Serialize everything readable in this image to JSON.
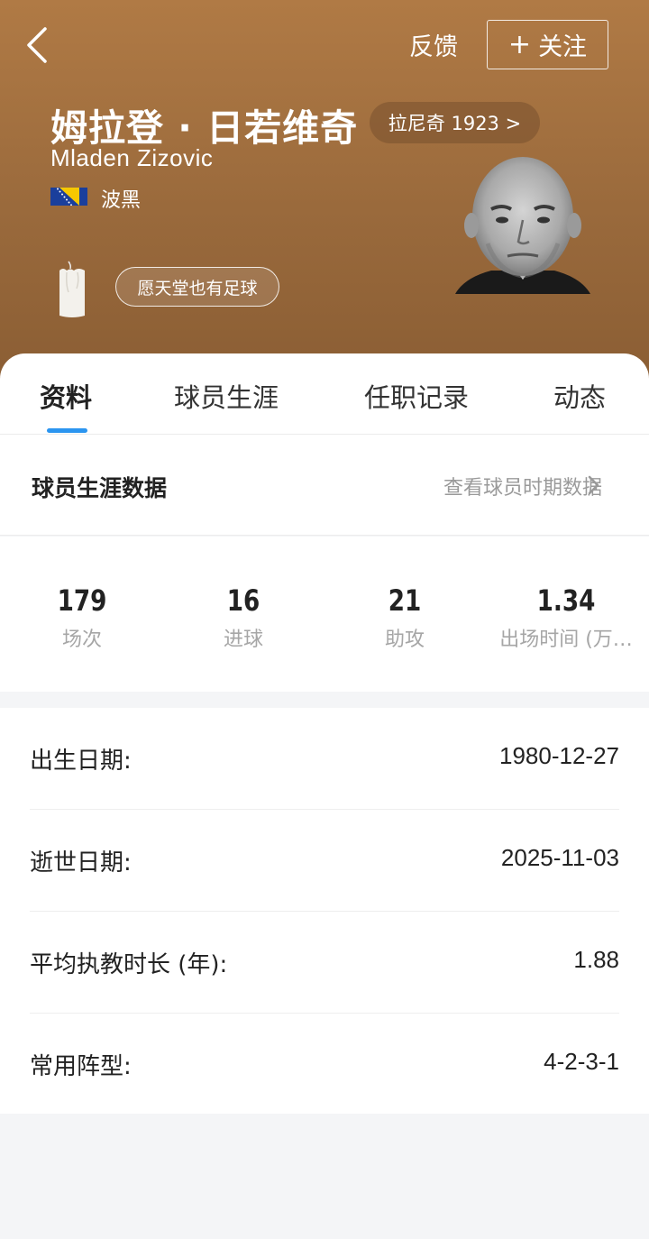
{
  "header": {
    "feedback_label": "反馈",
    "follow_label": "关注",
    "follow_plus": "+",
    "name_cn": "姆拉登 · 日若维奇",
    "name_en": "Mladen Zizovic",
    "club_link": "拉尼奇 1923 >",
    "country": "波黑",
    "memorial_label": "愿天堂也有足球",
    "bg_color": "#a06d3e"
  },
  "tabs": [
    {
      "label": "资料",
      "active": true
    },
    {
      "label": "球员生涯",
      "active": false
    },
    {
      "label": "任职记录",
      "active": false
    },
    {
      "label": "动态",
      "active": false
    }
  ],
  "career": {
    "title": "球员生涯数据",
    "link": "查看球员时期数据",
    "stats": [
      {
        "value": "179",
        "label": "场次"
      },
      {
        "value": "16",
        "label": "进球"
      },
      {
        "value": "21",
        "label": "助攻"
      },
      {
        "value": "1.34",
        "label": "出场时间 (万…"
      }
    ]
  },
  "info": [
    {
      "label": "出生日期:",
      "value": "1980-12-27"
    },
    {
      "label": "逝世日期:",
      "value": "2025-11-03"
    },
    {
      "label": "平均执教时长 (年):",
      "value": "1.88"
    },
    {
      "label": "常用阵型:",
      "value": "4-2-3-1"
    }
  ],
  "colors": {
    "accent": "#2b95f0",
    "muted": "#a6a6a6"
  }
}
